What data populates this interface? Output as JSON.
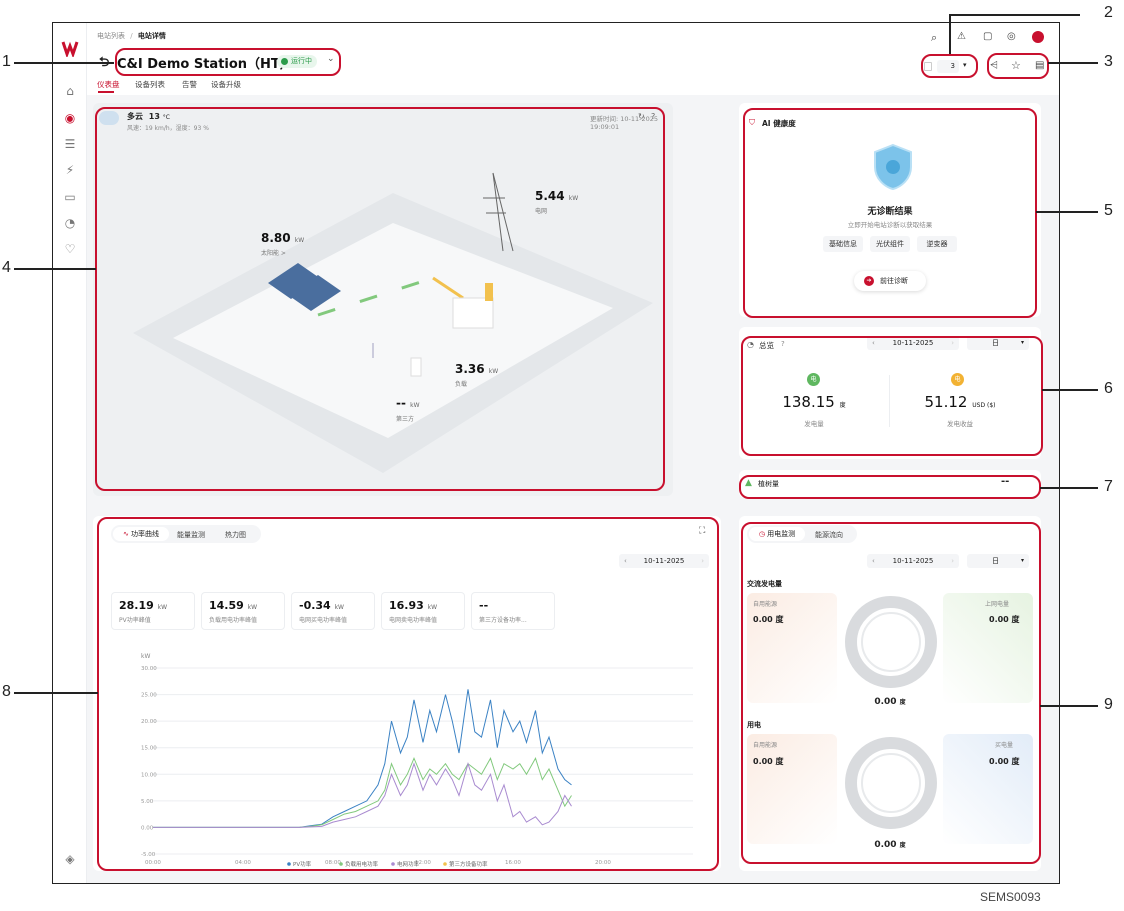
{
  "breadcrumb": {
    "parent": "电站列表",
    "sep": "/",
    "current": "电站详情"
  },
  "station": {
    "back": "⮌",
    "name": "C&I Demo Station（HT）",
    "status": "运行中"
  },
  "tabs": [
    "仪表盘",
    "设备列表",
    "告警",
    "设备升级"
  ],
  "toolbar": {
    "count": "3"
  },
  "weather": {
    "condition": "多云",
    "temp": "13",
    "temp_unit": "°C",
    "detail": "风速：19 km/h，湿度：93 %",
    "updated": "更新时间: 10-11-2025 19:09:01"
  },
  "flow": {
    "pv": {
      "value": "8.80",
      "unit": "kW",
      "label": "太阳能 >"
    },
    "grid": {
      "value": "5.44",
      "unit": "kW",
      "label": "电网"
    },
    "load": {
      "value": "3.36",
      "unit": "kW",
      "label": "负载"
    },
    "third": {
      "value": "--",
      "unit": "kW",
      "label": "第三方"
    }
  },
  "health": {
    "title": "AI 健康度",
    "result": "无诊断结果",
    "hint": "立即开始电站诊断以获取结果",
    "chips": [
      "基础信息",
      "光伏组件",
      "逆变器"
    ],
    "button": "前往诊断"
  },
  "overview": {
    "title": "总览",
    "date": "10-11-2025",
    "period": "日",
    "gen_value": "138.15",
    "gen_unit": "度",
    "gen_label": "发电量",
    "gen_badge": "电",
    "rev_value": "51.12",
    "rev_unit": "USD ($)",
    "rev_label": "发电收益",
    "rev_badge": "电"
  },
  "trees": {
    "label": "植树量",
    "value": "--"
  },
  "power": {
    "tabs": [
      "功率曲线",
      "能量监测",
      "热力图"
    ],
    "date": "10-11-2025",
    "kpis": [
      {
        "value": "28.19",
        "unit": "kW",
        "label": "PV功率峰值"
      },
      {
        "value": "14.59",
        "unit": "kW",
        "label": "负载用电功率峰值"
      },
      {
        "value": "-0.34",
        "unit": "kW",
        "label": "电网买电功率峰值"
      },
      {
        "value": "16.93",
        "unit": "kW",
        "label": "电网卖电功率峰值"
      },
      {
        "value": "--",
        "unit": "",
        "label": "第三方设备功率..."
      }
    ]
  },
  "energy": {
    "tabs": [
      "用电监测",
      "能源流向"
    ],
    "date": "10-11-2025",
    "period": "日",
    "ac_title": "交流发电量",
    "ac_left_label": "自用能源",
    "ac_left_value": "0.00 度",
    "ac_right_label": "上网电量",
    "ac_right_value": "0.00 度",
    "ac_total": "0.00",
    "use_title": "用电",
    "use_left_label": "自用能源",
    "use_left_value": "0.00 度",
    "use_right_label": "买电量",
    "use_right_value": "0.00 度",
    "use_total": "0.00",
    "total_unit": "度"
  },
  "footer_code": "SEMS0093",
  "callouts": [
    "1",
    "2",
    "3",
    "4",
    "5",
    "6",
    "7",
    "8",
    "9"
  ],
  "colors": {
    "accent": "#c8102e",
    "pv": "#3b82c4",
    "load": "#82c97d",
    "grid": "#a98bd0",
    "third": "#f2c14e"
  },
  "chart_data": {
    "type": "line",
    "ylabel": "kW",
    "ylim": [
      -5,
      30
    ],
    "yticks": [
      "30.00",
      "25.00",
      "20.00",
      "15.00",
      "10.00",
      "5.00",
      "0.00",
      "-5.00"
    ],
    "xticks": [
      "00:00",
      "04:00",
      "08:00",
      "12:00",
      "16:00",
      "20:00"
    ],
    "xlim": [
      0,
      24
    ],
    "series": [
      {
        "name": "PV功率",
        "color": "#3b82c4",
        "x": [
          0,
          6.5,
          7,
          7.5,
          8,
          8.5,
          9,
          9.5,
          10,
          10.3,
          10.6,
          11,
          11.3,
          11.6,
          12,
          12.3,
          12.6,
          13,
          13.3,
          13.6,
          14,
          14.3,
          14.6,
          15,
          15.3,
          15.6,
          16,
          16.3,
          16.6,
          17,
          17.3,
          17.6,
          18,
          18.3,
          18.6
        ],
        "y": [
          0,
          0,
          0.3,
          0.6,
          2,
          3,
          4,
          5,
          8,
          12,
          20,
          14,
          17,
          24,
          16,
          22,
          18,
          25,
          20,
          14,
          26,
          18,
          17,
          24,
          15,
          22,
          18,
          20,
          16,
          22,
          14,
          17,
          11,
          9,
          8
        ]
      },
      {
        "name": "负载用电功率",
        "color": "#82c97d",
        "x": [
          0,
          6.5,
          7,
          7.5,
          8,
          8.5,
          9,
          9.5,
          10,
          10.3,
          10.6,
          11,
          11.3,
          11.6,
          12,
          12.3,
          12.6,
          13,
          13.3,
          13.6,
          14,
          14.3,
          14.6,
          15,
          15.3,
          15.6,
          16,
          16.3,
          16.6,
          17,
          17.3,
          17.6,
          18,
          18.3,
          18.6
        ],
        "y": [
          0,
          0,
          0.2,
          0.5,
          1.5,
          2.5,
          3,
          4,
          5,
          7,
          12,
          8,
          10,
          13,
          9,
          11,
          10,
          12,
          10,
          9,
          12,
          11,
          10,
          13,
          9,
          12,
          11,
          12,
          10,
          13,
          9,
          11,
          7,
          4,
          6
        ]
      },
      {
        "name": "电网功率",
        "color": "#a98bd0",
        "x": [
          0,
          6.5,
          7,
          7.5,
          8,
          8.5,
          9,
          9.5,
          10,
          10.3,
          10.6,
          11,
          11.3,
          11.6,
          12,
          12.3,
          12.6,
          13,
          13.3,
          13.6,
          14,
          14.3,
          14.6,
          15,
          15.3,
          15.6,
          16,
          16.3,
          16.6,
          17,
          17.3,
          17.6,
          18,
          18.3,
          18.6
        ],
        "y": [
          0,
          0,
          0.1,
          0.2,
          1,
          1.5,
          2,
          3,
          4,
          6,
          10,
          6,
          8,
          12,
          7,
          10,
          8,
          11,
          9,
          6,
          12,
          8,
          7,
          10,
          5,
          8,
          2,
          3,
          1,
          2,
          0.5,
          1,
          3,
          6,
          4
        ]
      },
      {
        "name": "第三方设备功率",
        "color": "#f2c14e",
        "x": [],
        "y": []
      }
    ]
  }
}
